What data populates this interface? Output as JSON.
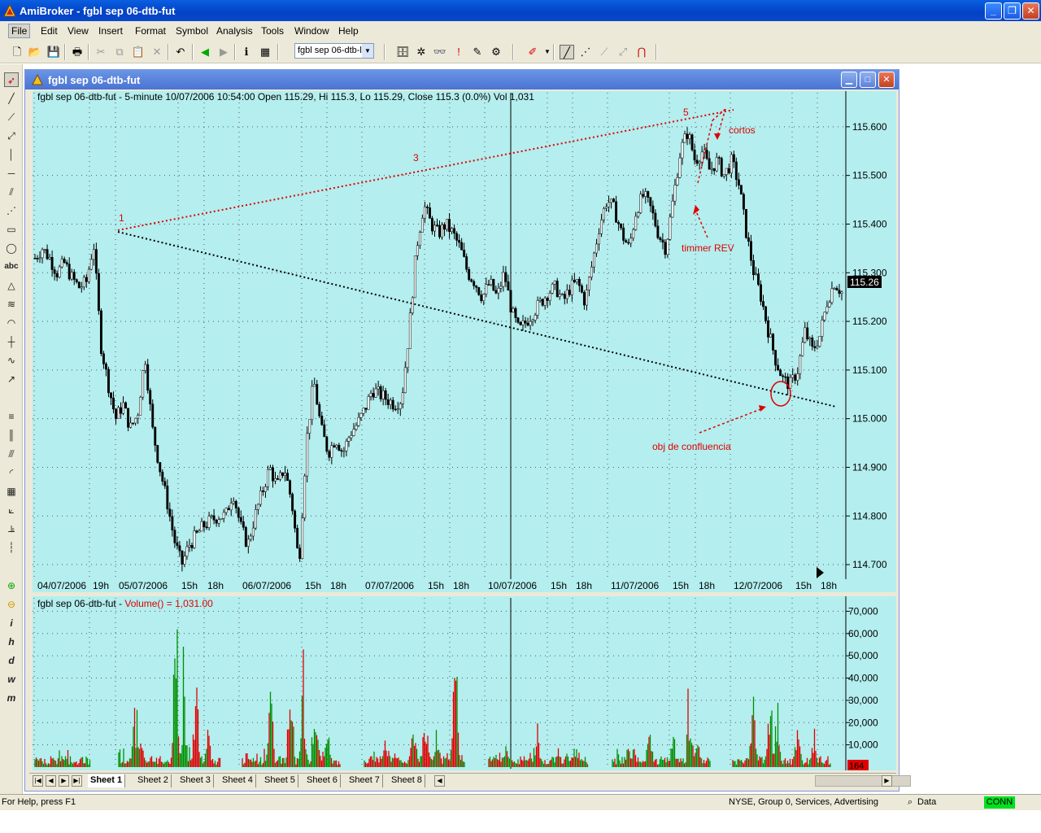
{
  "window": {
    "title": "AmiBroker - fgbl sep 06-dtb-fut",
    "min_label": "_",
    "max_label": "❐",
    "close_label": "✕"
  },
  "menu": {
    "items": [
      "File",
      "Edit",
      "View",
      "Insert",
      "Format",
      "Symbol",
      "Analysis",
      "Tools",
      "Window",
      "Help"
    ]
  },
  "toolbar": {
    "symbol_value": "fgbl sep 06-dtb-l",
    "icons": [
      "new-icon",
      "open-icon",
      "save-icon",
      "print-icon",
      "cut-icon",
      "copy-icon",
      "paste-icon",
      "delete-icon",
      "undo-icon",
      "back-icon",
      "forward-icon",
      "info-icon",
      "calendar-icon",
      "database-icon",
      "settings-icon",
      "binoculars-icon",
      "alert-icon",
      "edit-icon",
      "color-pen-icon",
      "draw-line-icon",
      "dotted-line-icon",
      "magnet-icon"
    ]
  },
  "chart_window": {
    "title": "fgbl sep 06-dtb-fut"
  },
  "price_chart": {
    "header": "fgbl sep 06-dtb-fut - 5-minute 10/07/2006 10:54:00 Open 115.29, Hi 115.3, Lo 115.29, Close 115.3 (0.0%) Vol 1,031",
    "y_ticks": [
      "115.600",
      "115.500",
      "115.400",
      "115.300",
      "115.200",
      "115.100",
      "115.000",
      "114.900",
      "114.800",
      "114.700"
    ],
    "y_tick_values": [
      115.6,
      115.5,
      115.4,
      115.3,
      115.2,
      115.1,
      115.0,
      114.9,
      114.8,
      114.7
    ],
    "x_labels": [
      "04/07/2006",
      "19h",
      "05/07/2006",
      "15h",
      "18h",
      "06/07/2006",
      "15h",
      "18h",
      "07/07/2006",
      "15h",
      "18h",
      "10/07/2006",
      "15h",
      "18h",
      "11/07/2006",
      "15h",
      "18h",
      "12/07/2006",
      "15h",
      "18h"
    ],
    "last_price_label": "115.26",
    "wave_labels": [
      "1",
      "3",
      "5"
    ],
    "annotations": {
      "cortos": "cortos",
      "timmer": "timmer REV",
      "obj": "obj de confluencia"
    },
    "ylim": [
      114.67,
      115.67
    ],
    "close_path": [
      115.33,
      115.35,
      115.33,
      115.3,
      115.32,
      115.29,
      115.27,
      115.28,
      115.36,
      115.15,
      115.07,
      115.0,
      115.03,
      114.98,
      115.01,
      115.13,
      114.98,
      114.9,
      114.83,
      114.75,
      114.7,
      114.74,
      114.76,
      114.78,
      114.79,
      114.8,
      114.8,
      114.85,
      114.78,
      114.74,
      114.8,
      114.85,
      114.9,
      114.86,
      114.9,
      114.83,
      114.7,
      114.95,
      115.08,
      114.98,
      114.93,
      114.96,
      114.93,
      114.97,
      114.99,
      115.02,
      115.06,
      115.05,
      115.04,
      115.03,
      115.04,
      115.18,
      115.35,
      115.44,
      115.4,
      115.38,
      115.4,
      115.38,
      115.35,
      115.3,
      115.28,
      115.25,
      115.28,
      115.25,
      115.3,
      115.22,
      115.18,
      115.2,
      115.22,
      115.24,
      115.26,
      115.27,
      115.24,
      115.27,
      115.28,
      115.24,
      115.32,
      115.4,
      115.45,
      115.43,
      115.38,
      115.35,
      115.43,
      115.46,
      115.43,
      115.38,
      115.35,
      115.45,
      115.55,
      115.59,
      115.53,
      115.55,
      115.51,
      115.53,
      115.5,
      115.53,
      115.48,
      115.38,
      115.3,
      115.25,
      115.18,
      115.12,
      115.08,
      115.07,
      115.1,
      115.18,
      115.14,
      115.17,
      115.24,
      115.28,
      115.26
    ]
  },
  "volume_chart": {
    "header": "fgbl sep 06-dtb-fut - ",
    "indicator": "Volume() = 1,031.00",
    "y_ticks": [
      "70,000",
      "60,000",
      "50,000",
      "40,000",
      "30,000",
      "20,000",
      "10,000"
    ],
    "y_tick_values": [
      70000,
      60000,
      50000,
      40000,
      30000,
      20000,
      10000
    ],
    "ylim": [
      0,
      76000
    ],
    "last_value_label": "164",
    "sessions": [
      {
        "start": 0,
        "end": 68,
        "peaks": [
          [
            12,
            2200
          ],
          [
            30,
            1500
          ],
          [
            55,
            1800
          ]
        ]
      },
      {
        "start": 103,
        "end": 228,
        "peaks": [
          [
            20,
            28000
          ],
          [
            28,
            18000
          ],
          [
            70,
            73000
          ],
          [
            80,
            40000
          ],
          [
            95,
            52000
          ],
          [
            110,
            20000
          ]
        ]
      },
      {
        "start": 255,
        "end": 375,
        "peaks": [
          [
            35,
            40000
          ],
          [
            60,
            42000
          ],
          [
            75,
            45000
          ],
          [
            90,
            38000
          ],
          [
            105,
            20000
          ]
        ]
      },
      {
        "start": 405,
        "end": 528,
        "peaks": [
          [
            25,
            15000
          ],
          [
            60,
            25000
          ],
          [
            75,
            30000
          ],
          [
            112,
            78000
          ],
          [
            90,
            18000
          ]
        ]
      },
      {
        "start": 558,
        "end": 680,
        "peaks": [
          [
            20,
            12000
          ],
          [
            60,
            15000
          ],
          [
            85,
            12000
          ],
          [
            105,
            9000
          ]
        ]
      },
      {
        "start": 710,
        "end": 830,
        "peaks": [
          [
            20,
            13000
          ],
          [
            45,
            20000
          ],
          [
            75,
            18000
          ],
          [
            95,
            30000
          ],
          [
            105,
            15000
          ]
        ]
      },
      {
        "start": 858,
        "end": 978,
        "peaks": [
          [
            25,
            35000
          ],
          [
            45,
            35000
          ],
          [
            55,
            32000
          ],
          [
            80,
            25000
          ],
          [
            100,
            20000
          ]
        ]
      }
    ]
  },
  "sheets": {
    "tabs": [
      "Sheet 1",
      "Sheet 2",
      "Sheet 3",
      "Sheet 4",
      "Sheet 5",
      "Sheet 6",
      "Sheet 7",
      "Sheet 8"
    ]
  },
  "status": {
    "help": "For Help, press F1",
    "market": "NYSE, Group 0, Services, Advertising",
    "data": "Data",
    "conn": "CONN"
  },
  "left_toolbar": {
    "icons": [
      "pointer-icon",
      "line-icon",
      "ray-icon",
      "extended-line-icon",
      "vertical-line-icon",
      "horizontal-line-icon",
      "parallel-channel-icon",
      "regression-icon",
      "rectangle-icon",
      "ellipse-icon",
      "text-icon",
      "triangle-icon",
      "fibonacci-icon",
      "arc-icon",
      "cycles-icon",
      "zigzag-icon",
      "arrow-tool-icon",
      "lines-icon",
      "bars-icon",
      "gann-icon",
      "fan-icon",
      "grid-icon",
      "gann-fan-icon",
      "pitchfork-icon",
      "quote-icon",
      "plus-icon",
      "minus-icon",
      "intraday-icon",
      "hourly-icon",
      "daily-icon",
      "weekly-icon",
      "monthly-icon"
    ],
    "labels": {
      "text": "abc",
      "i": "i",
      "h": "h",
      "d": "d",
      "w": "w",
      "m": "m"
    }
  },
  "colors": {
    "pane_bg": "#b4eeee",
    "up_bar": "#009000",
    "down_bar": "#e00000",
    "annotation": "#e00000"
  }
}
